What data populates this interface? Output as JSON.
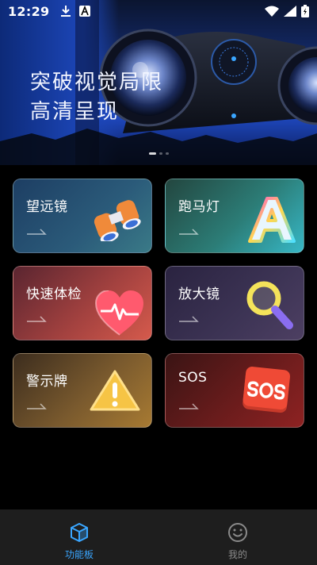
{
  "status_bar": {
    "time": "12:29",
    "icons_left": [
      "download-icon",
      "font-a-icon"
    ],
    "icons_right": [
      "wifi-icon",
      "signal-icon",
      "battery-icon"
    ]
  },
  "hero": {
    "title_line1": "突破视觉局限",
    "title_line2": "高清呈现",
    "page_count": 3,
    "active_page": 1
  },
  "features": [
    {
      "label": "望远镜",
      "icon": "binoculars-icon"
    },
    {
      "label": "跑马灯",
      "icon": "neon-letter-a-icon"
    },
    {
      "label": "快速体检",
      "icon": "heart-pulse-icon"
    },
    {
      "label": "放大镜",
      "icon": "magnifier-icon"
    },
    {
      "label": "警示牌",
      "icon": "warning-sign-icon"
    },
    {
      "label": "SOS",
      "icon": "sos-sign-icon"
    }
  ],
  "bottom_nav": {
    "items": [
      {
        "label": "功能板",
        "icon": "cube-icon",
        "active": true
      },
      {
        "label": "我的",
        "icon": "smiley-icon",
        "active": false
      }
    ],
    "active_color": "#3aa6ff",
    "inactive_color": "#8a8a8a"
  }
}
